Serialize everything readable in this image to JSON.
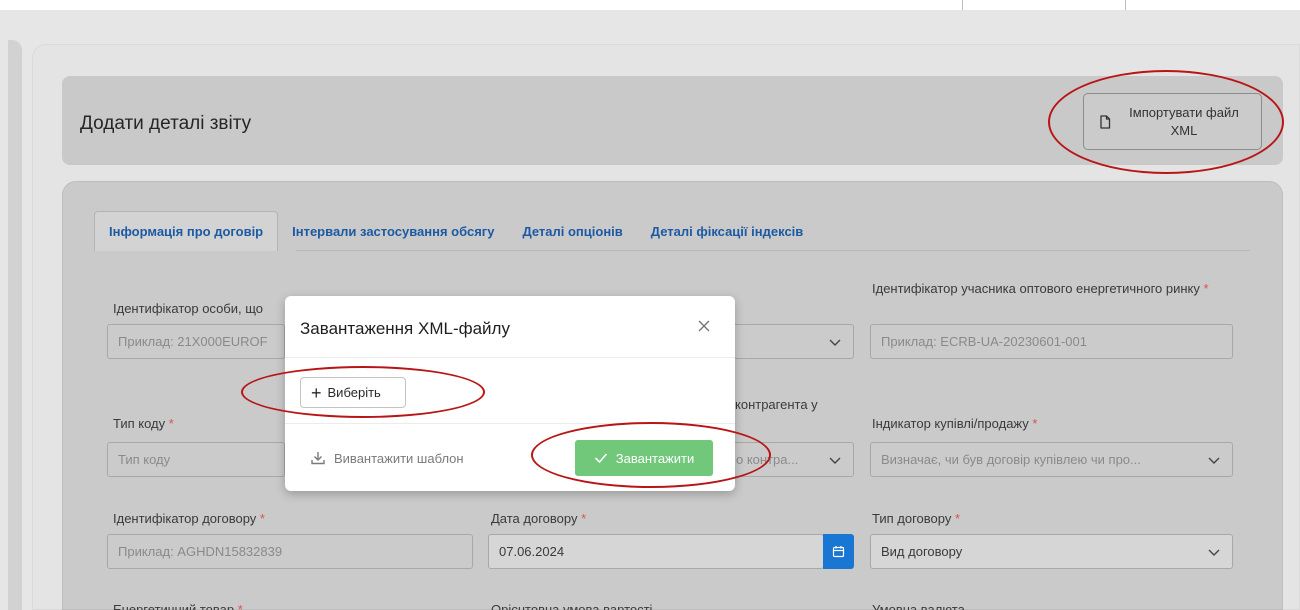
{
  "page": {
    "title": "Додати деталі звіту",
    "import_button": "Імпортувати файл XML"
  },
  "tabs": [
    {
      "label": "Інформація про договір",
      "active": true
    },
    {
      "label": "Інтервали застосування обсягу",
      "active": false
    },
    {
      "label": "Деталі опціонів",
      "active": false
    },
    {
      "label": "Деталі фіксації індексів",
      "active": false
    }
  ],
  "form": {
    "row1": {
      "col1_label": "Ідентифікатор особи, що",
      "col1_placeholder": "Приклад: 21X000EUROF",
      "col3_label": "Ідентифікатор учасника оптового енергетичного ринку",
      "col3_placeholder": "Приклад: ECRB-UA-20230601-001"
    },
    "row2": {
      "col1_label": "Тип коду",
      "col1_placeholder": "Тип коду",
      "col2_label_partial": "контрагента у",
      "col2_placeholder_partial": "о контра...",
      "col3_label": "Індикатор купівлі/продажу",
      "col3_placeholder": "Визначає, чи був договір купівлею чи про..."
    },
    "row3": {
      "col1_label": "Ідентифікатор договору",
      "col1_placeholder": "Приклад: AGHDN15832839",
      "col2_label": "Дата договору",
      "col2_value": "07.06.2024",
      "col3_label": "Тип договору",
      "col3_placeholder": "Вид договору"
    },
    "row4": {
      "col1_label": "Енергетичний товар",
      "col2_label": "Орієнтовна умова вартості",
      "col3_label": "Умовна валюта"
    },
    "required_mark": "*"
  },
  "modal": {
    "title": "Завантаження XML-файлу",
    "choose_button": "Виберіть",
    "download_template": "Вивантажити шаблон",
    "upload_button": "Завантажити"
  },
  "colors": {
    "link_blue": "#1c5aa3",
    "calendar_blue": "#1976d2",
    "upload_green": "#71c77a",
    "required_red": "#d9534f",
    "annotation_red": "#b81616"
  }
}
